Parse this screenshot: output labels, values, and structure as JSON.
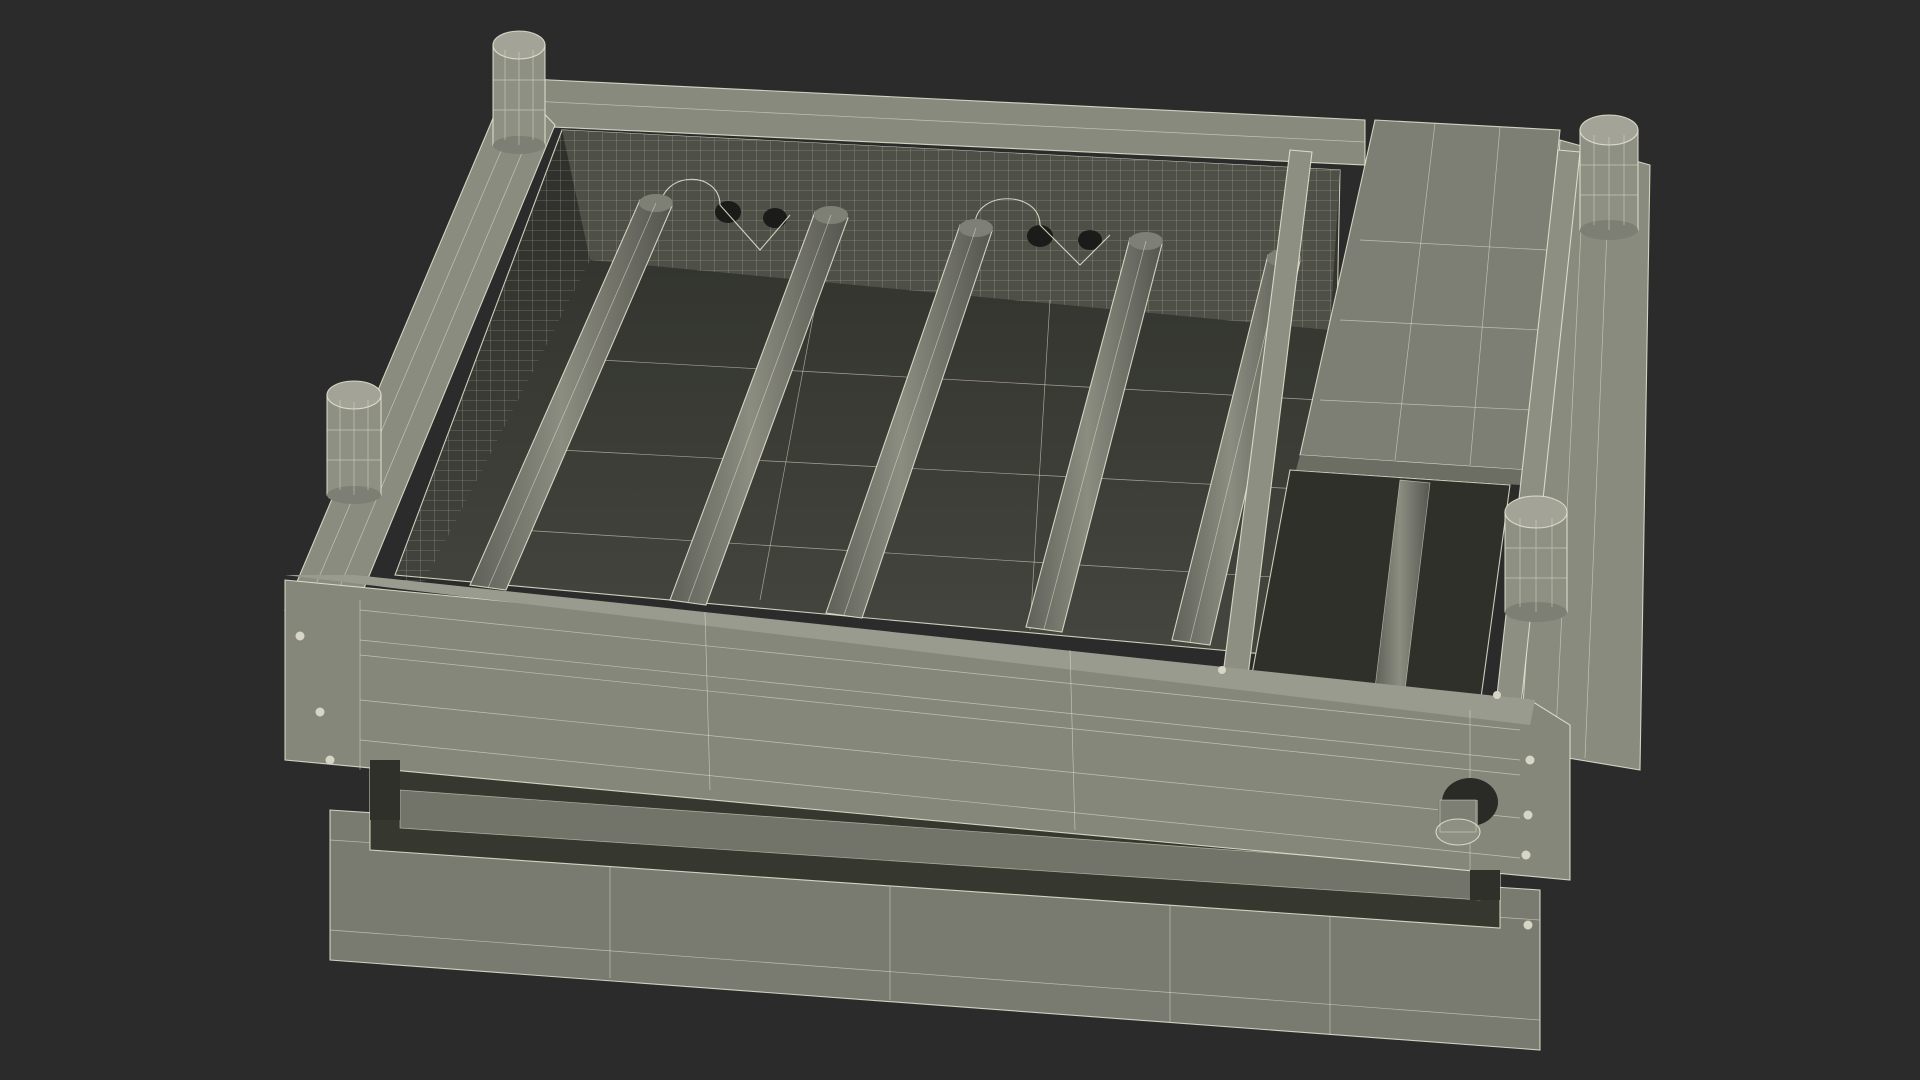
{
  "scene": {
    "background_color": "#2b2b2b",
    "model_surface_color": "#7c7d71",
    "model_dark_surface_color": "#3d3e38",
    "wireframe_color": "#e9e7d4",
    "render_style": "wireframe-over-shaded",
    "tube_count": 5,
    "leg_count": 4
  }
}
